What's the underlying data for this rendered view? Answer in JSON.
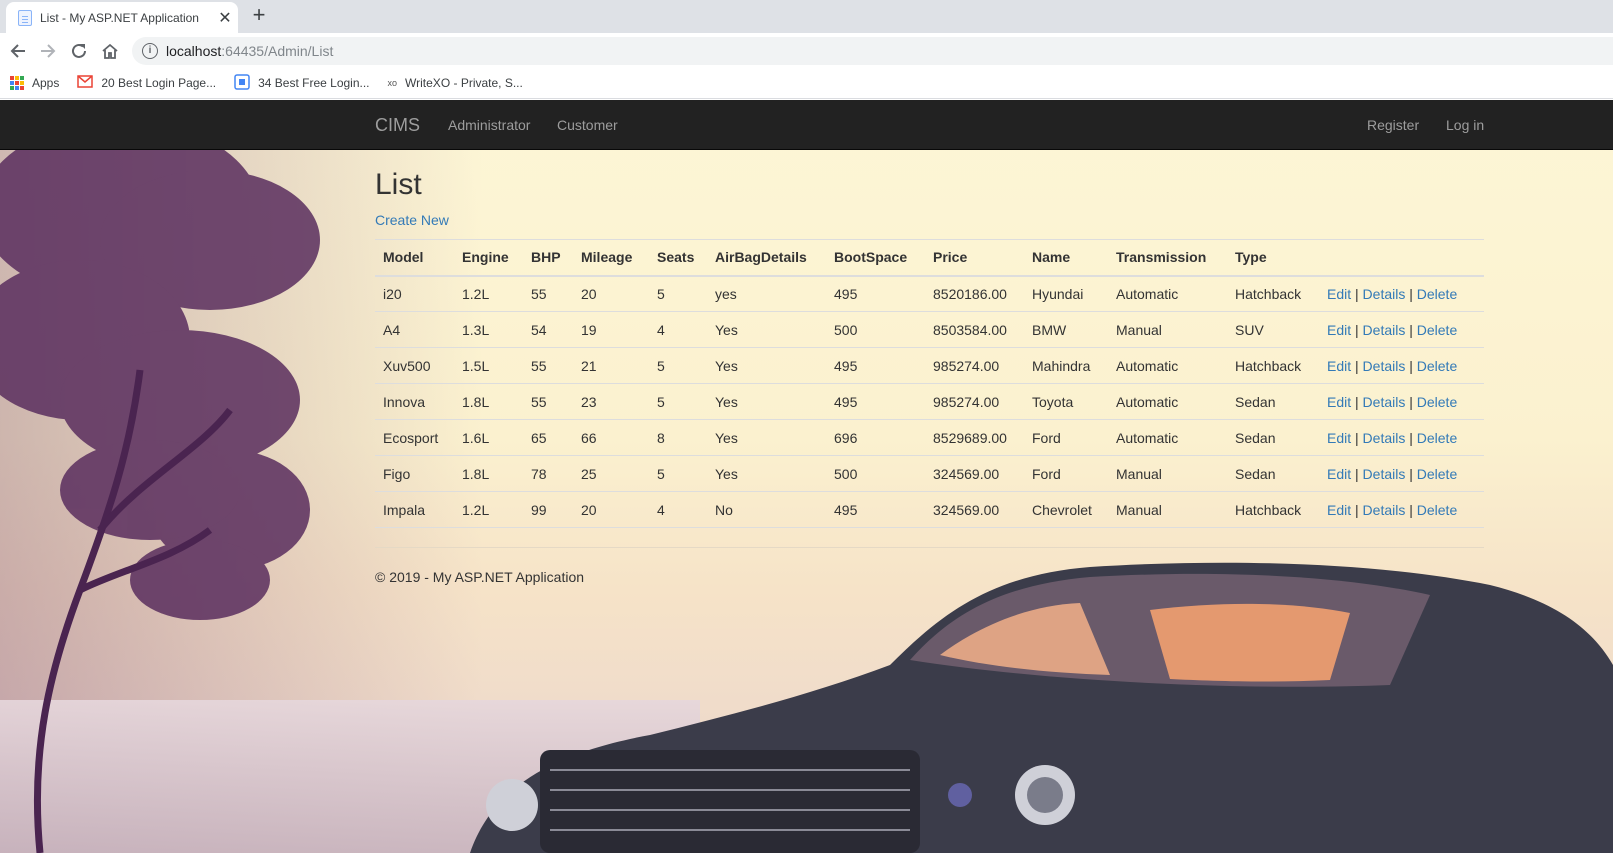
{
  "browser": {
    "tab_title": "List - My ASP.NET Application",
    "tab_close": "✕",
    "new_tab": "+",
    "url_host": "localhost",
    "url_path": ":64435/Admin/List",
    "info_glyph": "i",
    "bookmarks": [
      {
        "label": "Apps",
        "icon": "apps-grid-icon"
      },
      {
        "label": "20 Best Login Page...",
        "icon": "gmail-icon"
      },
      {
        "label": "34 Best Free Login...",
        "icon": "bookmark-page-icon"
      },
      {
        "label": "WriteXO - Private, S...",
        "icon": "xo-icon"
      }
    ],
    "xo_glyph": "xo"
  },
  "site": {
    "brand": "CIMS",
    "nav_left": [
      "Administrator",
      "Customer"
    ],
    "nav_right": [
      "Register",
      "Log in"
    ],
    "page_title": "List",
    "create_new": "Create New",
    "columns": [
      "Model",
      "Engine",
      "BHP",
      "Mileage",
      "Seats",
      "AirBagDetails",
      "BootSpace",
      "Price",
      "Name",
      "Transmission",
      "Type"
    ],
    "rows": [
      [
        "i20",
        "1.2L",
        "55",
        "20",
        "5",
        "yes",
        "495",
        "8520186.00",
        "Hyundai",
        "Automatic",
        "Hatchback"
      ],
      [
        "A4",
        "1.3L",
        "54",
        "19",
        "4",
        "Yes",
        "500",
        "8503584.00",
        "BMW",
        "Manual",
        "SUV"
      ],
      [
        "Xuv500",
        "1.5L",
        "55",
        "21",
        "5",
        "Yes",
        "495",
        "985274.00",
        "Mahindra",
        "Automatic",
        "Hatchback"
      ],
      [
        "Innova",
        "1.8L",
        "55",
        "23",
        "5",
        "Yes",
        "495",
        "985274.00",
        "Toyota",
        "Automatic",
        "Sedan"
      ],
      [
        "Ecosport",
        "1.6L",
        "65",
        "66",
        "8",
        "Yes",
        "696",
        "8529689.00",
        "Ford",
        "Automatic",
        "Sedan"
      ],
      [
        "Figo",
        "1.8L",
        "78",
        "25",
        "5",
        "Yes",
        "500",
        "324569.00",
        "Ford",
        "Manual",
        "Sedan"
      ],
      [
        "Impala",
        "1.2L",
        "99",
        "20",
        "4",
        "No",
        "495",
        "324569.00",
        "Chevrolet",
        "Manual",
        "Hatchback"
      ]
    ],
    "actions": {
      "edit": "Edit",
      "details": "Details",
      "delete": "Delete",
      "separator": "|"
    },
    "footer": "© 2019 - My ASP.NET Application"
  },
  "colors": {
    "navbar_bg": "#222222",
    "nav_text": "#9d9d9d",
    "link": "#337ab7",
    "page_bg": "#fbf1cf"
  }
}
